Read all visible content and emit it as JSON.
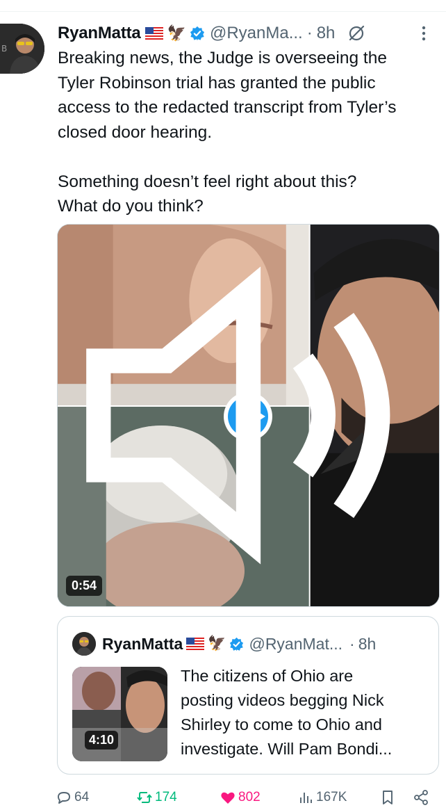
{
  "tweet": {
    "author_name": "RyanMatta",
    "author_flag": "🇺🇸",
    "author_badge": "eagle",
    "handle": "@RyanMa...",
    "separator": "·",
    "time": "8h",
    "text_lines": [
      "Breaking news, the Judge is overseeing the",
      "Tyler Robinson trial has granted the public",
      "access to the redacted transcript from Tyler’s",
      "closed door hearing.",
      "",
      "Something doesn’t feel right about this?",
      "What do you think?"
    ],
    "video": {
      "duration": "0:54",
      "icons": [
        "play-icon",
        "volume-icon"
      ]
    }
  },
  "quoted_tweet": {
    "author_name": "RyanMatta",
    "author_flag": "🇺🇸",
    "handle": "@RyanMat...",
    "separator": "·",
    "time": "8h",
    "video_duration": "4:10",
    "text_lines": [
      "The citizens of Ohio are",
      "posting videos begging Nick",
      "Shirley to come to Ohio and",
      "investigate. Will Pam Bondi..."
    ]
  },
  "actions": {
    "replies": "64",
    "reposts": "174",
    "likes": "802",
    "views": "167K"
  },
  "colors": {
    "accent_blue": "#1d9bf0",
    "repost_green": "#00ba7c",
    "like_pink": "#f91880",
    "muted_text": "#536471",
    "border": "#cfd9de"
  }
}
